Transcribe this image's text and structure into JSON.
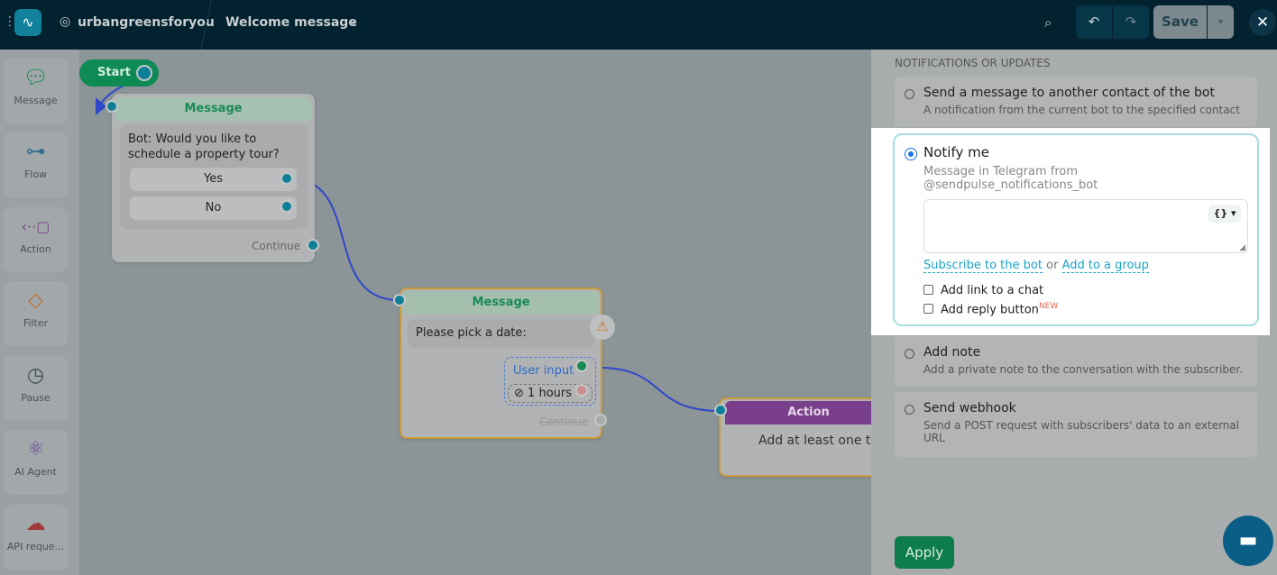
{
  "header": {
    "account": "urbangreensforyou",
    "flow_title": "Welcome message",
    "save": "Save"
  },
  "sidebar": {
    "items": [
      {
        "label": "Message",
        "icon": "chat-bubble-icon"
      },
      {
        "label": "Flow",
        "icon": "flow-icon"
      },
      {
        "label": "Action",
        "icon": "action-icon"
      },
      {
        "label": "Filter",
        "icon": "filter-icon"
      },
      {
        "label": "Pause",
        "icon": "timer-icon"
      },
      {
        "label": "AI Agent",
        "icon": "ai-atom-icon"
      },
      {
        "label": "API reque...",
        "icon": "cloud-api-icon"
      }
    ]
  },
  "canvas": {
    "start": "Start",
    "node1": {
      "title": "Message",
      "text": "Bot: Would you like to schedule a property tour?",
      "buttons": [
        "Yes",
        "No"
      ],
      "continue": "Continue"
    },
    "node2": {
      "title": "Message",
      "text": "Please pick a date:",
      "user_input": "User input",
      "timeout": "1 hours",
      "continue": "Continue"
    },
    "node3": {
      "title": "Action",
      "text": "Add at least one t"
    }
  },
  "panel": {
    "section": "NOTIFICATIONS OR UPDATES",
    "options": [
      {
        "title": "Send a message to another contact of the bot",
        "desc": "A notification from the current bot to the specified contact"
      },
      {
        "title": "Notify me",
        "desc": "Message in Telegram from @sendpulse_notifications_bot",
        "selected": true
      },
      {
        "title": "Add note",
        "desc": "Add a private note to the conversation with the subscriber."
      },
      {
        "title": "Send webhook",
        "desc": "Send a POST request with subscribers' data to an external URL"
      }
    ],
    "notify": {
      "message_value": "",
      "var_button": "{}",
      "subscribe": "Subscribe to the bot",
      "or": "or",
      "group": "Add to a group",
      "add_link": "Add link to a chat",
      "add_reply": "Add reply button",
      "new_badge": "NEW"
    },
    "apply": "Apply"
  },
  "colors": {
    "accent": "#1aa3c9",
    "green": "#0e8a55",
    "action": "#7a3f8c"
  }
}
